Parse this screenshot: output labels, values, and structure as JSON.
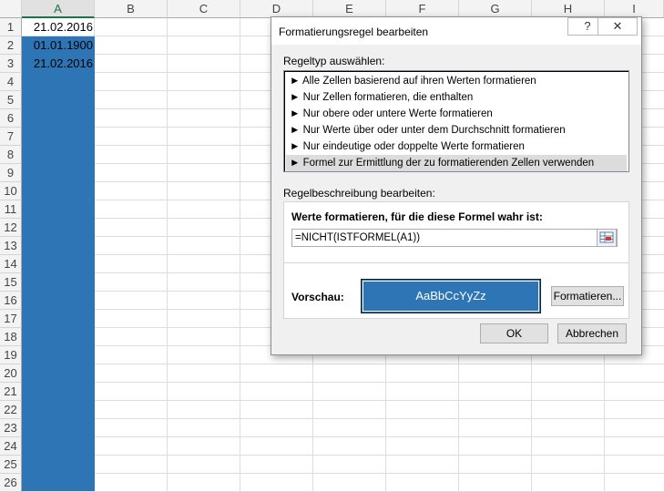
{
  "sheet": {
    "columns": [
      "A",
      "B",
      "C",
      "D",
      "E",
      "F",
      "G",
      "H",
      "I"
    ],
    "rows": [
      "1",
      "2",
      "3",
      "4",
      "5",
      "6",
      "7",
      "8",
      "9",
      "10",
      "11",
      "12",
      "13",
      "14",
      "15",
      "16",
      "17",
      "18",
      "19",
      "20",
      "21",
      "22",
      "23",
      "24",
      "25",
      "26"
    ],
    "cells": [
      "21.02.2016",
      "01.01.1900",
      "21.02.2016"
    ],
    "highlight_color": "#2e75b6"
  },
  "dialog": {
    "title": "Formatierungsregel bearbeiten",
    "help_label": "?",
    "close_label": "✕",
    "ruletype_label": "Regeltyp auswählen:",
    "rule_types": [
      "► Alle Zellen basierend auf ihren Werten formatieren",
      "► Nur Zellen formatieren, die enthalten",
      "► Nur obere oder untere Werte formatieren",
      "► Nur Werte über oder unter dem Durchschnitt formatieren",
      "► Nur eindeutige oder doppelte Werte formatieren",
      "► Formel zur Ermittlung der zu formatierenden Zellen verwenden"
    ],
    "selected_rule_index": 5,
    "desc_label": "Regelbeschreibung bearbeiten:",
    "formula_label": "Werte formatieren, für die diese Formel wahr ist:",
    "formula_value": "=NICHT(ISTFORMEL(A1))",
    "preview_label": "Vorschau:",
    "preview_text": "AaBbCcYyZz",
    "format_button": "Formatieren...",
    "ok_button": "OK",
    "cancel_button": "Abbrechen"
  }
}
